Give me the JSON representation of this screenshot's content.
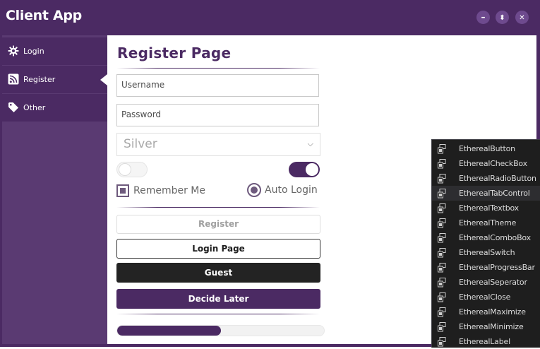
{
  "window": {
    "title": "Client App",
    "controls": {
      "minimize": "–",
      "maximize": "⬍",
      "close": "✕"
    }
  },
  "sidebar": {
    "items": [
      {
        "label": "Login",
        "icon": "gear-icon",
        "active": false
      },
      {
        "label": "Register",
        "icon": "rss-icon",
        "active": true
      },
      {
        "label": "Other",
        "icon": "tag-icon",
        "active": false
      }
    ]
  },
  "register": {
    "title": "Register Page",
    "username_placeholder": "Username",
    "password_placeholder": "Password",
    "combo_value": "Silver",
    "switch_left_on": false,
    "switch_right_on": true,
    "remember_me_label": "Remember Me",
    "remember_me_checked": true,
    "auto_login_label": "Auto Login",
    "auto_login_selected": true,
    "buttons": {
      "register": "Register",
      "login_page": "Login Page",
      "guest": "Guest",
      "decide_later": "Decide Later"
    },
    "progress_percent": 50
  },
  "context_menu": {
    "items": [
      "EtherealButton",
      "EtherealCheckBox",
      "EtherealRadioButton",
      "EtherealTabControl",
      "EtherealTextbox",
      "EtherealTheme",
      "EtherealComboBox",
      "EtherealSwitch",
      "EtherealProgressBar",
      "EtherealSeperator",
      "EtherealClose",
      "EtherealMaximize",
      "EtherealMinimize",
      "EtherealLabel"
    ],
    "hovered_index": 3,
    "item_icon": "component-icon"
  },
  "colors": {
    "accent": "#4b2a63",
    "sidebar": "#5a3a72",
    "button_dark": "#232323",
    "menu_bg": "#1e1e1e"
  }
}
